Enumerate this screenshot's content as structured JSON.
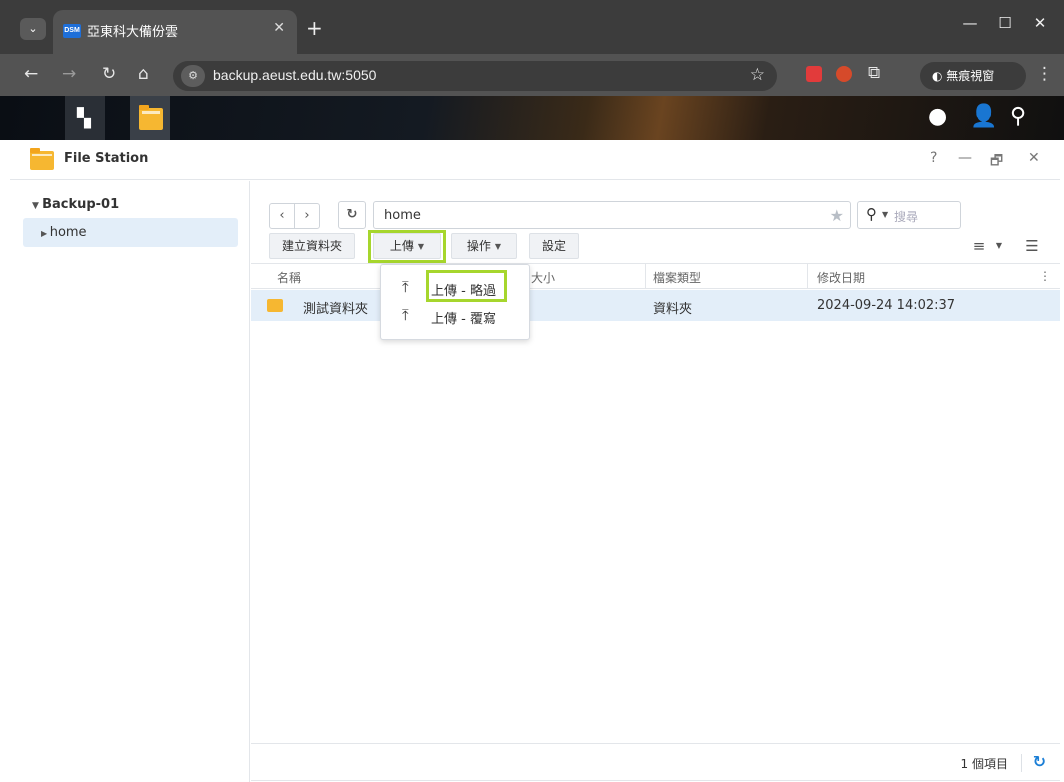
{
  "browser": {
    "tab_title": "亞東科大備份雲",
    "favicon_text": "DSM",
    "url": "backup.aeust.edu.tw:5050",
    "incognito_label": "無痕視窗"
  },
  "window": {
    "title": "File Station",
    "help": "?",
    "minimize": "—",
    "restore": "🗗",
    "close": "✕"
  },
  "tree": {
    "root": "Backup-01",
    "items": [
      {
        "label": "home"
      }
    ]
  },
  "toolbar": {
    "path": "home",
    "search_placeholder": "搜尋",
    "create_folder": "建立資料夾",
    "upload": "上傳",
    "action": "操作",
    "settings": "設定"
  },
  "upload_menu": {
    "items": [
      {
        "label": "上傳 - 略過"
      },
      {
        "label": "上傳 - 覆寫"
      }
    ]
  },
  "table": {
    "columns": [
      "名稱",
      "大小",
      "檔案類型",
      "修改日期"
    ],
    "rows": [
      {
        "name": "測試資料夾",
        "size": "",
        "type": "資料夾",
        "modified": "2024-09-24 14:02:37"
      }
    ]
  },
  "status": {
    "count": "1 個項目"
  },
  "colors": {
    "highlight": "#a6d62d",
    "selection": "#e3eef9",
    "accent": "#1c7fd6"
  }
}
